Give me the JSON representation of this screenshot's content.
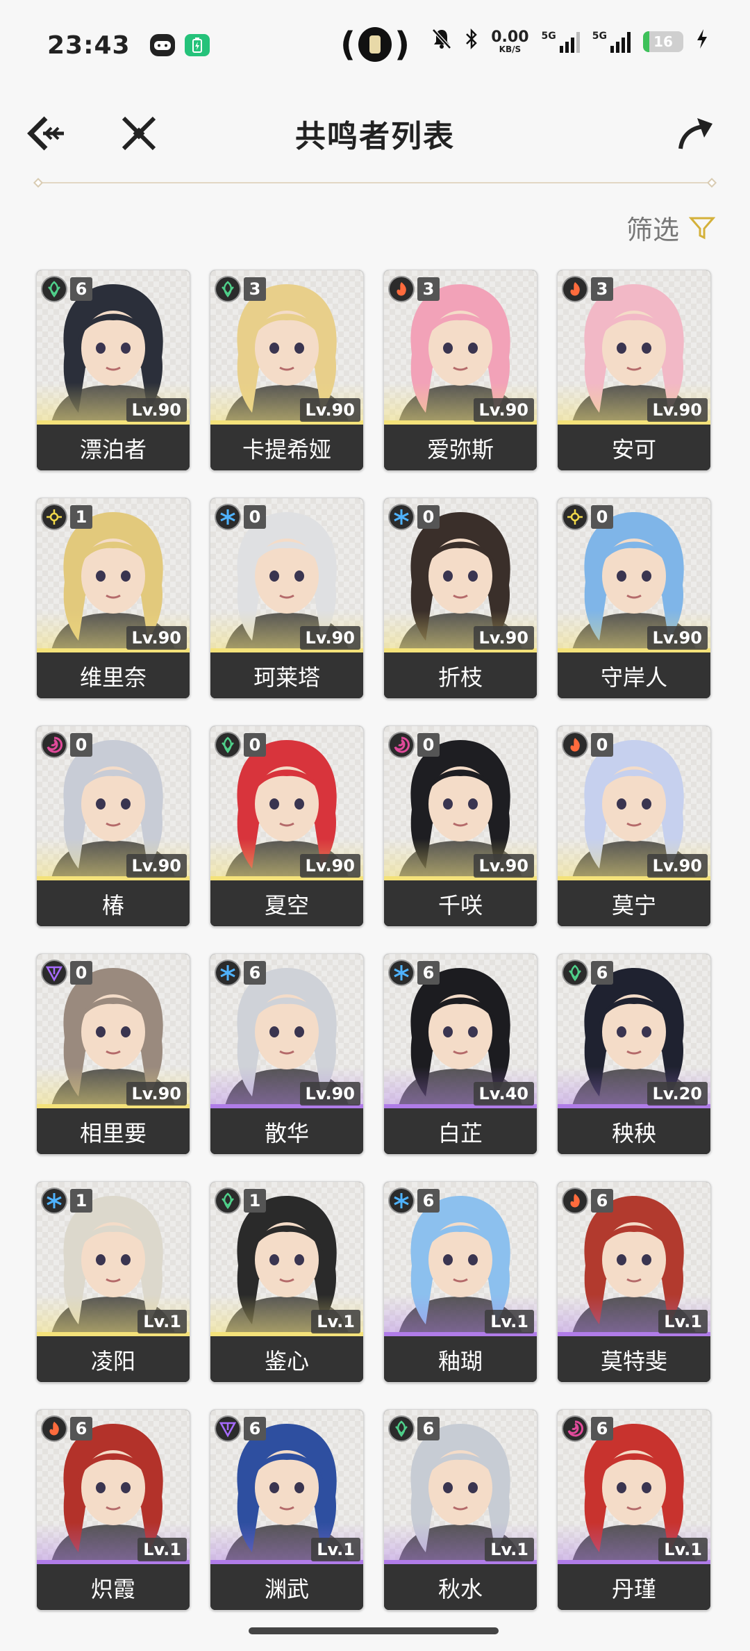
{
  "status": {
    "time": "23:43",
    "net_speed_value": "0.00",
    "net_speed_unit": "KB/S",
    "signal1_label": "5G",
    "signal2_label": "5G",
    "battery": "16",
    "battery_level": 0.16
  },
  "header": {
    "title": "共鸣者列表"
  },
  "filter": {
    "label": "筛选"
  },
  "element_colors": {
    "aero": "#4fd08a",
    "fusion": "#ff6b3d",
    "glacio": "#4fb3ff",
    "spectro": "#f1d94a",
    "havoc": "#e04a9a",
    "electro": "#a66bff"
  },
  "rarity_colors": {
    "five_star": "#f4e27a",
    "four_star": "#b07ce8"
  },
  "characters": [
    {
      "name": "漂泊者",
      "seq": "6",
      "level": "Lv.90",
      "element": "aero",
      "rarity": "r5"
    },
    {
      "name": "卡提希娅",
      "seq": "3",
      "level": "Lv.90",
      "element": "aero",
      "rarity": "r5"
    },
    {
      "name": "爱弥斯",
      "seq": "3",
      "level": "Lv.90",
      "element": "fusion",
      "rarity": "r5"
    },
    {
      "name": "安可",
      "seq": "3",
      "level": "Lv.90",
      "element": "fusion",
      "rarity": "r5"
    },
    {
      "name": "维里奈",
      "seq": "1",
      "level": "Lv.90",
      "element": "spectro",
      "rarity": "r5"
    },
    {
      "name": "珂莱塔",
      "seq": "0",
      "level": "Lv.90",
      "element": "glacio",
      "rarity": "r5"
    },
    {
      "name": "折枝",
      "seq": "0",
      "level": "Lv.90",
      "element": "glacio",
      "rarity": "r5"
    },
    {
      "name": "守岸人",
      "seq": "0",
      "level": "Lv.90",
      "element": "spectro",
      "rarity": "r5"
    },
    {
      "name": "椿",
      "seq": "0",
      "level": "Lv.90",
      "element": "havoc",
      "rarity": "r5"
    },
    {
      "name": "夏空",
      "seq": "0",
      "level": "Lv.90",
      "element": "aero",
      "rarity": "r5"
    },
    {
      "name": "千咲",
      "seq": "0",
      "level": "Lv.90",
      "element": "havoc",
      "rarity": "r5"
    },
    {
      "name": "莫宁",
      "seq": "0",
      "level": "Lv.90",
      "element": "fusion",
      "rarity": "r5"
    },
    {
      "name": "相里要",
      "seq": "0",
      "level": "Lv.90",
      "element": "electro",
      "rarity": "r5"
    },
    {
      "name": "散华",
      "seq": "6",
      "level": "Lv.90",
      "element": "glacio",
      "rarity": "r4"
    },
    {
      "name": "白芷",
      "seq": "6",
      "level": "Lv.40",
      "element": "glacio",
      "rarity": "r4"
    },
    {
      "name": "秧秧",
      "seq": "6",
      "level": "Lv.20",
      "element": "aero",
      "rarity": "r4"
    },
    {
      "name": "凌阳",
      "seq": "1",
      "level": "Lv.1",
      "element": "glacio",
      "rarity": "r5"
    },
    {
      "name": "鉴心",
      "seq": "1",
      "level": "Lv.1",
      "element": "aero",
      "rarity": "r5"
    },
    {
      "name": "釉瑚",
      "seq": "6",
      "level": "Lv.1",
      "element": "glacio",
      "rarity": "r4"
    },
    {
      "name": "莫特斐",
      "seq": "6",
      "level": "Lv.1",
      "element": "fusion",
      "rarity": "r4"
    },
    {
      "name": "炽霞",
      "seq": "6",
      "level": "Lv.1",
      "element": "fusion",
      "rarity": "r4"
    },
    {
      "name": "渊武",
      "seq": "6",
      "level": "Lv.1",
      "element": "electro",
      "rarity": "r4"
    },
    {
      "name": "秋水",
      "seq": "6",
      "level": "Lv.1",
      "element": "aero",
      "rarity": "r4"
    },
    {
      "name": "丹瑾",
      "seq": "6",
      "level": "Lv.1",
      "element": "havoc",
      "rarity": "r4"
    }
  ]
}
